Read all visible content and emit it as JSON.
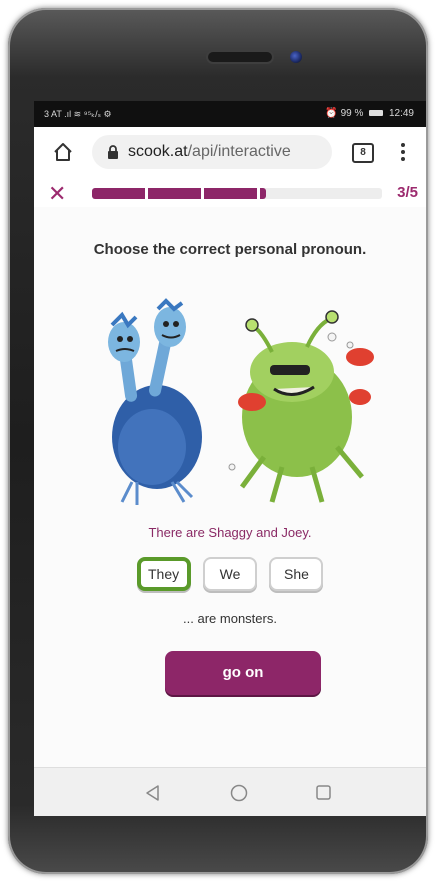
{
  "status_bar": {
    "left": "3 AT .ıl ≋ ⁹⁵ₖ/ₛ ⚙",
    "battery_text": "99 %",
    "time": "12:49"
  },
  "browser": {
    "url_host": "scook.at",
    "url_path": "/api/interactive",
    "tab_count": "8"
  },
  "progress": {
    "count": "3/5",
    "fraction": 0.6,
    "color": "#8d2668"
  },
  "exercise": {
    "instruction": "Choose the correct personal pronoun.",
    "sentence": "There are Shaggy and Joey.",
    "options": [
      "They",
      "We",
      "She"
    ],
    "selected": "They",
    "continuation": "... are monsters.",
    "go_on_label": "go on"
  },
  "colors": {
    "accent": "#8d2668",
    "selected_border": "#5a9a2a"
  }
}
